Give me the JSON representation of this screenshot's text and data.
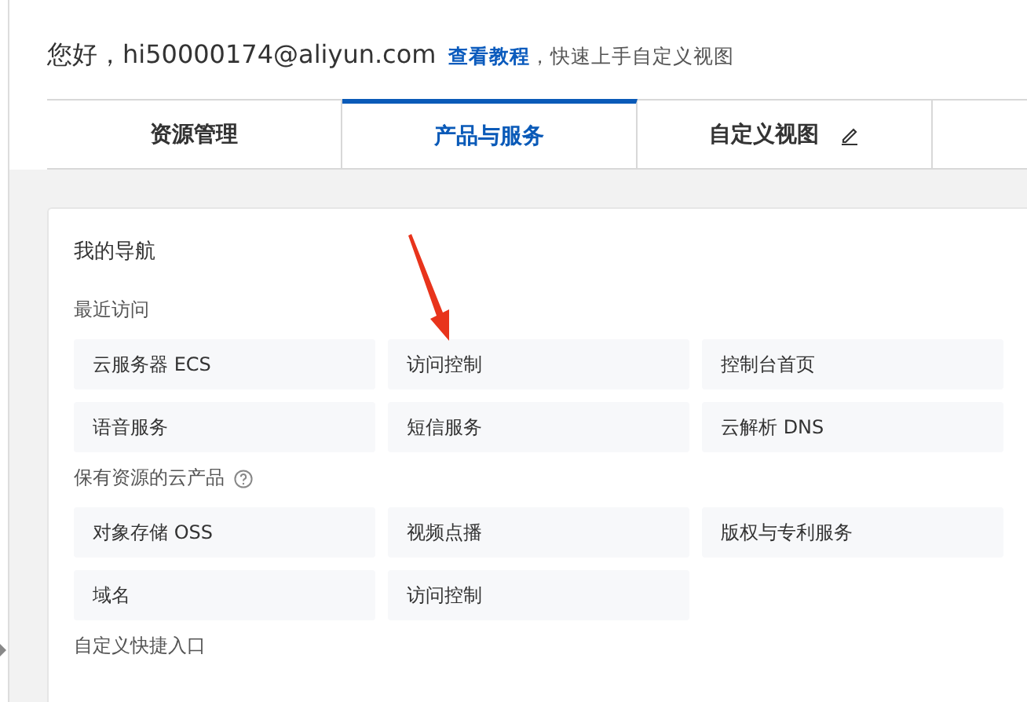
{
  "greeting": "您好，hi50000174@aliyun.com",
  "tutorial_link": "查看教程",
  "tutorial_hint": "，快速上手自定义视图",
  "tabs": [
    {
      "label": "资源管理",
      "selected": false,
      "editable": false
    },
    {
      "label": "产品与服务",
      "selected": true,
      "editable": false
    },
    {
      "label": "自定义视图",
      "selected": false,
      "editable": true
    }
  ],
  "nav": {
    "title": "我的导航",
    "sections": [
      {
        "title": "最近访问",
        "help": false,
        "items": [
          "云服务器 ECS",
          "访问控制",
          "控制台首页",
          "语音服务",
          "短信服务",
          "云解析 DNS"
        ]
      },
      {
        "title": "保有资源的云产品",
        "help": true,
        "items": [
          "对象存储 OSS",
          "视频点播",
          "版权与专利服务",
          "域名",
          "访问控制"
        ]
      },
      {
        "title": "自定义快捷入口",
        "help": false
      }
    ]
  }
}
